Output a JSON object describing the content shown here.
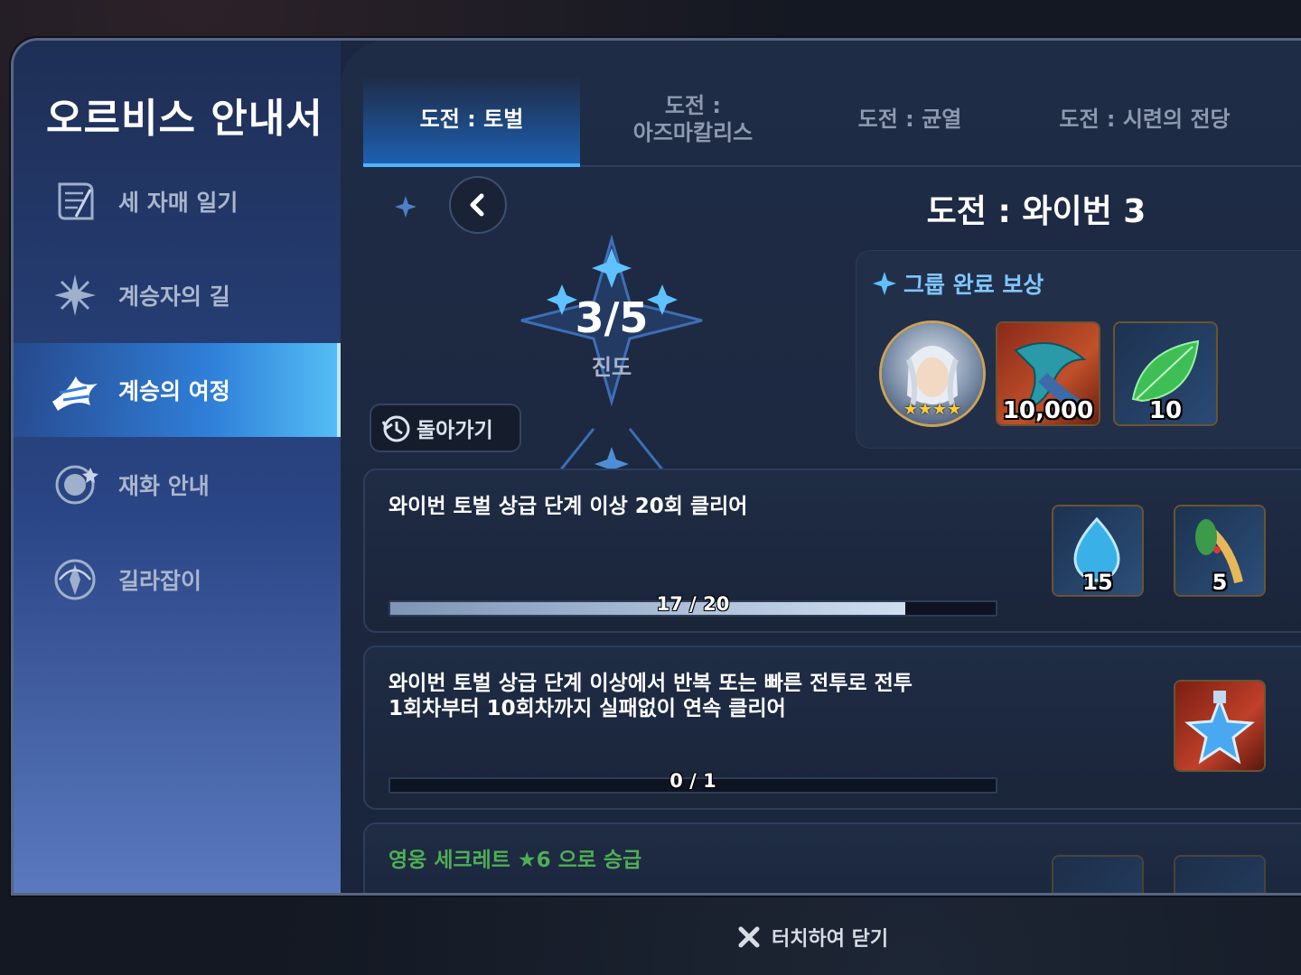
{
  "window": {
    "title": "오르비스 안내서"
  },
  "sidebar": {
    "items": [
      {
        "label": "세 자매 일기",
        "icon": "scroll-icon"
      },
      {
        "label": "계승자의 길",
        "icon": "star-burst-icon"
      },
      {
        "label": "계승의 여정",
        "icon": "dragon-claw-icon",
        "active": true
      },
      {
        "label": "재화 안내",
        "icon": "coin-icon"
      },
      {
        "label": "길라잡이",
        "icon": "compass-icon"
      }
    ]
  },
  "tabs": [
    {
      "label": "도전 : 토벌",
      "active": true
    },
    {
      "label": "도전 :\n아즈마칼리스"
    },
    {
      "label": "도전 : 균열"
    },
    {
      "label": "도전 : 시련의 전당"
    }
  ],
  "stage": {
    "title": "도전 : 와이번 3",
    "progress_text": "3/5",
    "progress_label": "진도",
    "return_label": "돌아가기"
  },
  "group_reward": {
    "header": "그룹 완료 보상",
    "items": [
      {
        "icon": "hero-portrait-icon",
        "stars": 4
      },
      {
        "icon": "scale-feather-icon",
        "count": "10,000"
      },
      {
        "icon": "green-leaf-icon",
        "count": "10"
      }
    ]
  },
  "missions": [
    {
      "desc": "와이번 토벌 상급 단계 이상 20회 클리어",
      "progress_text": "17 / 20",
      "progress": 0.85,
      "rewards": [
        {
          "icon": "water-drop-icon",
          "count": "15"
        },
        {
          "icon": "root-herb-icon",
          "count": "5"
        }
      ]
    },
    {
      "desc": "와이번 토벌 상급 단계 이상에서 반복 또는 빠른 전투로 전투\n1회차부터 10회차까지 실패없이 연속 클리어",
      "progress_text": "0 / 1",
      "progress": 0,
      "rewards": [
        {
          "icon": "star-potion-icon"
        }
      ]
    },
    {
      "desc": "영웅 세크레트 ★6 으로 승급",
      "rewards": [
        {
          "icon": "item-icon"
        },
        {
          "icon": "item-icon"
        }
      ]
    }
  ],
  "close_hint": "터치하여 닫기",
  "colors": {
    "accent": "#4fb3ff",
    "green_text": "#4fae55"
  }
}
